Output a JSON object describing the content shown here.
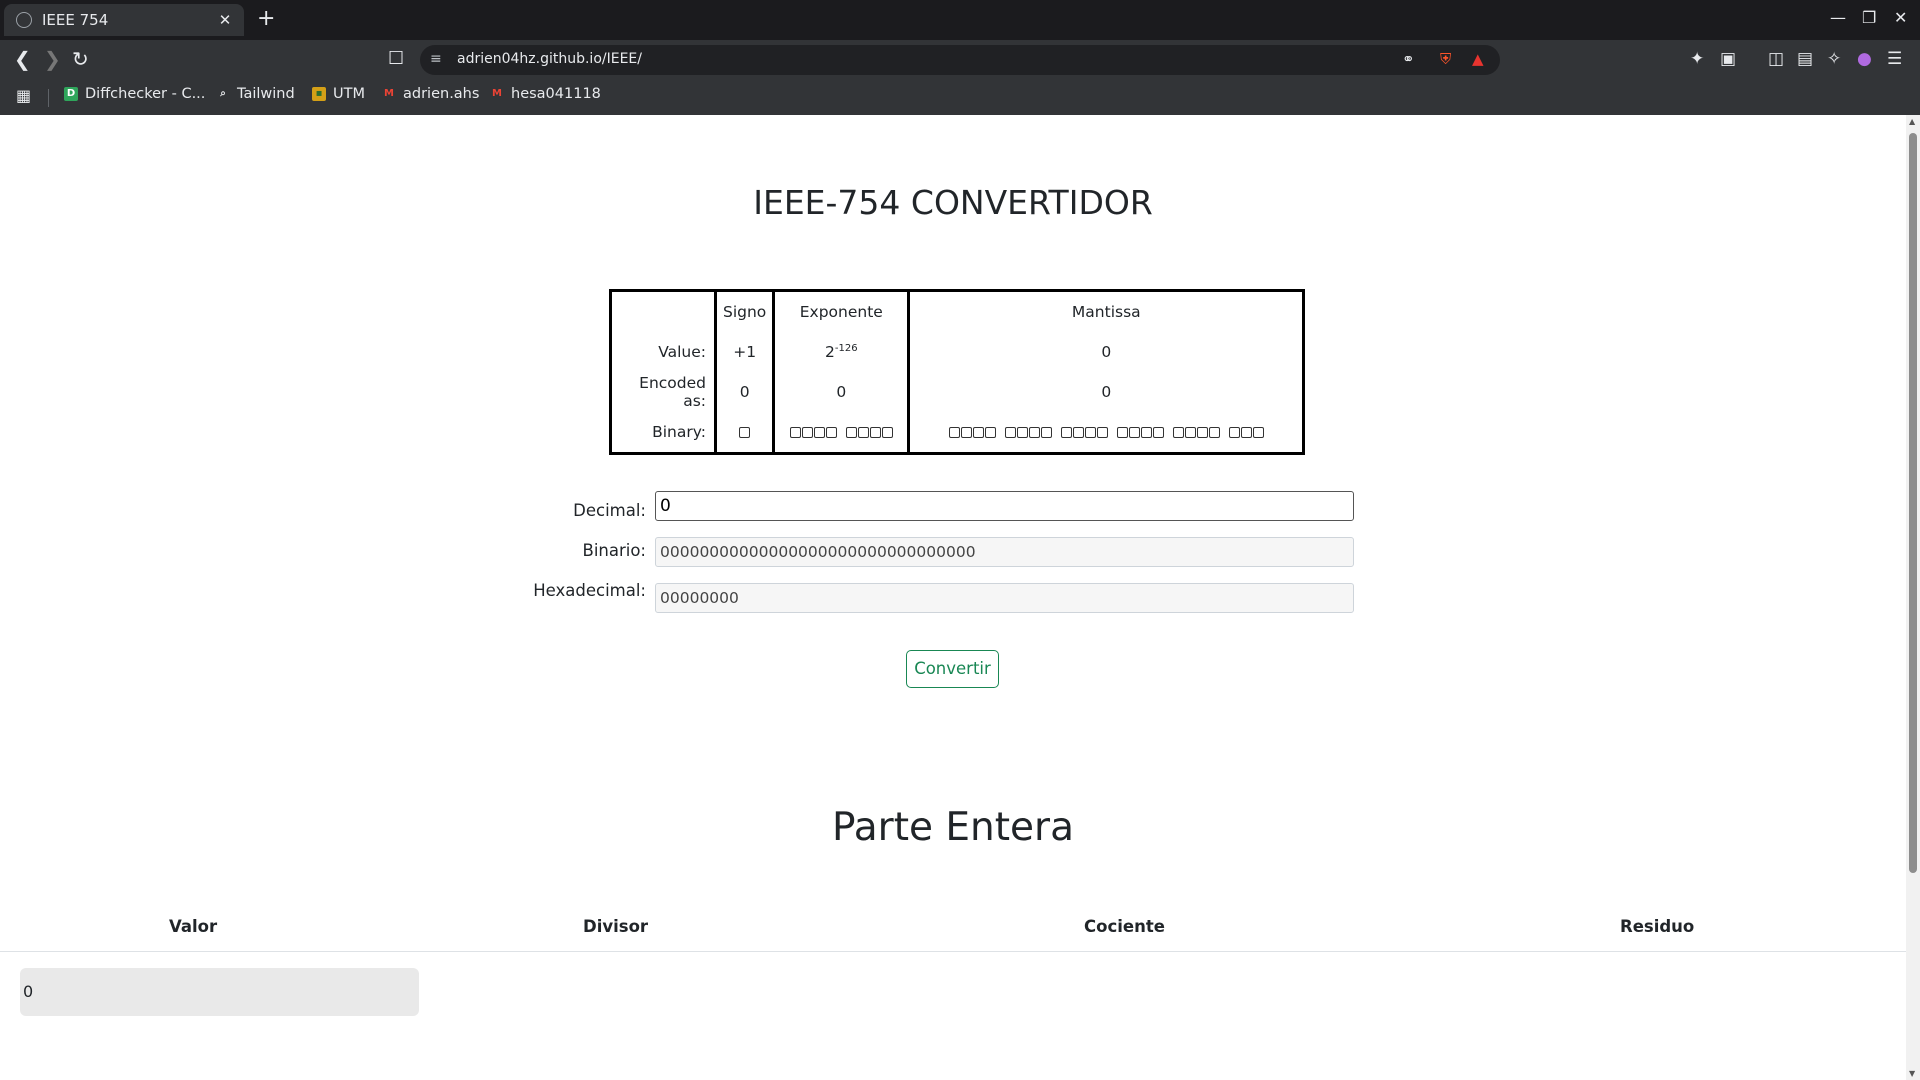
{
  "browser": {
    "tab_title": "IEEE 754",
    "tab_close": "✕",
    "new_tab": "+",
    "url": "adrien04hz.github.io/IEEE/",
    "bookmarks": [
      {
        "label": "Diffchecker - C...",
        "icon": "D",
        "color": "#2fa55b"
      },
      {
        "label": "Tailwind",
        "icon": "⌕",
        "color": "#e8eaed"
      },
      {
        "label": "UTM",
        "icon": "▪",
        "color": "#d4a017"
      },
      {
        "label": "adrien.ahs",
        "icon": "M",
        "color": "#ea4335"
      },
      {
        "label": "hesa041118",
        "icon": "M",
        "color": "#ea4335"
      }
    ]
  },
  "page": {
    "title": "IEEE-754 CONVERTIDOR",
    "table": {
      "headers": {
        "sign": "Signo",
        "exponent": "Exponente",
        "mantissa": "Mantissa"
      },
      "row_labels": {
        "value": "Value:",
        "encoded": "Encoded as:",
        "binary": "Binary:"
      },
      "value": {
        "sign": "+1",
        "exp_base": "2",
        "exp_power": "-126",
        "mantissa": "0"
      },
      "encoded": {
        "sign": "0",
        "exponent": "0",
        "mantissa": "0"
      }
    },
    "form": {
      "decimal_label": "Decimal:",
      "decimal_value": "0",
      "binary_label": "Binario:",
      "binary_value": "00000000000000000000000000000000",
      "hex_label": "Hexadecimal:",
      "hex_value": "00000000",
      "convert_button": "Convertir"
    },
    "integer_section": {
      "title": "Parte Entera",
      "columns": [
        "Valor",
        "Divisor",
        "Cociente",
        "Residuo"
      ],
      "value_cell": "0"
    }
  }
}
